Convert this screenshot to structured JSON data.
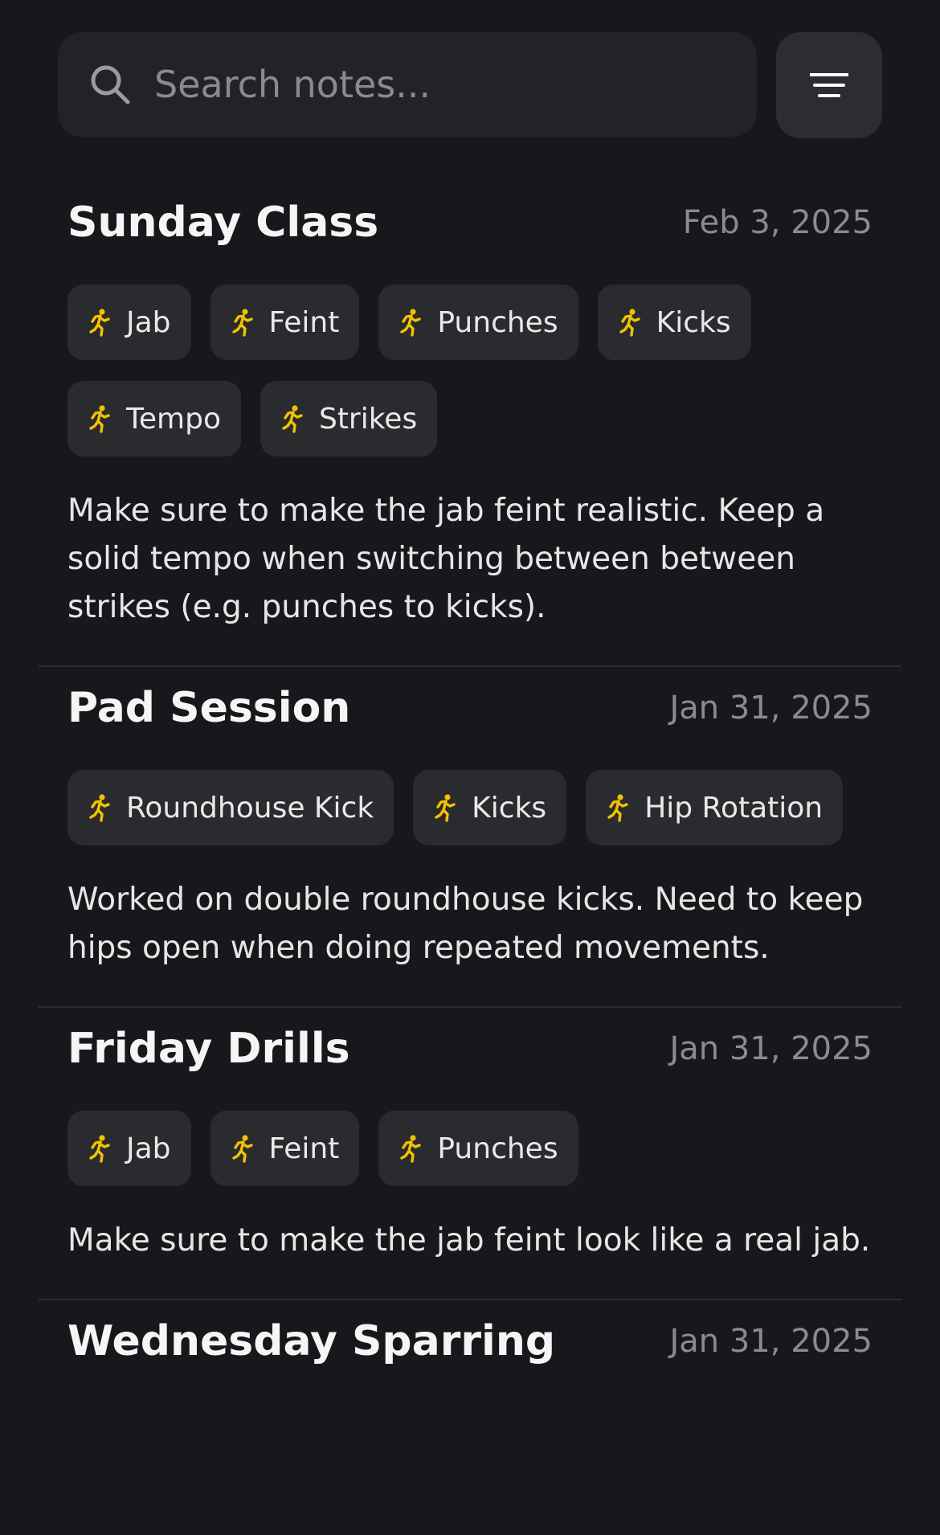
{
  "search": {
    "placeholder": "Search notes..."
  },
  "icons": {
    "search": "search-icon",
    "filter": "filter-icon",
    "tag": "person-running-icon"
  },
  "colors": {
    "background": "#17181b",
    "card": "#2a2b2e",
    "accent": "#f2c200",
    "muted_text": "#8a8b90"
  },
  "notes": [
    {
      "title": "Sunday Class",
      "date": "Feb 3, 2025",
      "tags": [
        "Jab",
        "Feint",
        "Punches",
        "Kicks",
        "Tempo",
        "Strikes"
      ],
      "body": "Make sure to make the jab feint realistic. Keep a solid tempo when switching between between strikes (e.g. punches to kicks)."
    },
    {
      "title": "Pad Session",
      "date": "Jan 31, 2025",
      "tags": [
        "Roundhouse Kick",
        "Kicks",
        "Hip Rotation"
      ],
      "body": "Worked on double roundhouse kicks. Need to keep hips open when doing repeated movements."
    },
    {
      "title": "Friday Drills",
      "date": "Jan 31, 2025",
      "tags": [
        "Jab",
        "Feint",
        "Punches"
      ],
      "body": "Make sure to make the jab feint look like a real jab."
    },
    {
      "title": "Wednesday Sparring",
      "date": "Jan 31, 2025",
      "tags": [],
      "body": ""
    }
  ]
}
